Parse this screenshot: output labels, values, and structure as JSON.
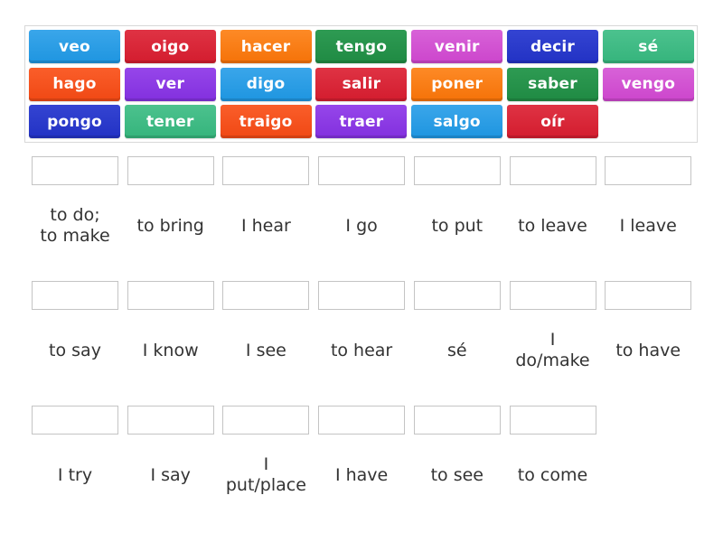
{
  "tiles": [
    {
      "text": "veo",
      "color": "#1e95e0",
      "color_light": "#3aa6ea"
    },
    {
      "text": "oigo",
      "color": "#d31c2e",
      "color_light": "#df3344"
    },
    {
      "text": "hacer",
      "color": "#f57208",
      "color_light": "#fd8a26"
    },
    {
      "text": "tengo",
      "color": "#1f8a43",
      "color_light": "#2e9b53"
    },
    {
      "text": "venir",
      "color": "#cc45cc",
      "color_light": "#d862d8"
    },
    {
      "text": "decir",
      "color": "#2232c4",
      "color_light": "#3444d2"
    },
    {
      "text": "sé",
      "color": "#35b47c",
      "color_light": "#4cc28e"
    },
    {
      "text": "hago",
      "color": "#f04814",
      "color_light": "#fa5e2a"
    },
    {
      "text": "ver",
      "color": "#8230de",
      "color_light": "#9646ea"
    },
    {
      "text": "digo",
      "color": "#1e95e0",
      "color_light": "#3aa6ea"
    },
    {
      "text": "salir",
      "color": "#d31c2e",
      "color_light": "#df3344"
    },
    {
      "text": "poner",
      "color": "#f57208",
      "color_light": "#fd8a26"
    },
    {
      "text": "saber",
      "color": "#1f8a43",
      "color_light": "#2e9b53"
    },
    {
      "text": "vengo",
      "color": "#cc45cc",
      "color_light": "#d862d8"
    },
    {
      "text": "pongo",
      "color": "#2232c4",
      "color_light": "#3444d2"
    },
    {
      "text": "tener",
      "color": "#35b47c",
      "color_light": "#4cc28e"
    },
    {
      "text": "traigo",
      "color": "#f04814",
      "color_light": "#fa5e2a"
    },
    {
      "text": "traer",
      "color": "#8230de",
      "color_light": "#9646ea"
    },
    {
      "text": "salgo",
      "color": "#1e95e0",
      "color_light": "#3aa6ea"
    },
    {
      "text": "oír",
      "color": "#d31c2e",
      "color_light": "#df3344"
    }
  ],
  "targets": [
    {
      "label": "to do;\nto make",
      "value": ""
    },
    {
      "label": "to bring",
      "value": ""
    },
    {
      "label": "I hear",
      "value": ""
    },
    {
      "label": "I go",
      "value": ""
    },
    {
      "label": "to put",
      "value": ""
    },
    {
      "label": "to leave",
      "value": ""
    },
    {
      "label": "I leave",
      "value": ""
    },
    {
      "label": "to say",
      "value": ""
    },
    {
      "label": "I know",
      "value": ""
    },
    {
      "label": "I see",
      "value": ""
    },
    {
      "label": "to hear",
      "value": ""
    },
    {
      "label": "sé",
      "value": ""
    },
    {
      "label": "I\ndo/make",
      "value": ""
    },
    {
      "label": "to have",
      "value": ""
    },
    {
      "label": "I try",
      "value": ""
    },
    {
      "label": "I say",
      "value": ""
    },
    {
      "label": "I\nput/place",
      "value": ""
    },
    {
      "label": "I have",
      "value": ""
    },
    {
      "label": "to see",
      "value": ""
    },
    {
      "label": "to come",
      "value": ""
    }
  ]
}
